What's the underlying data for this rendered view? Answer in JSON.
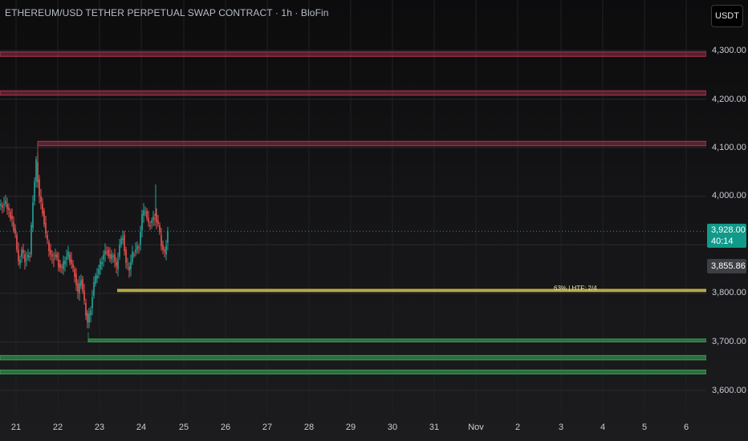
{
  "header": {
    "title": "ETHEREUM/USD TETHER PERPETUAL SWAP CONTRACT · 1h · BloFin",
    "currency_button": "USDT"
  },
  "price_axis": {
    "ticks": [
      "4,300.00",
      "4,200.00",
      "4,100.00",
      "4,000.00",
      "3,800.00",
      "3,700.00",
      "3,600.00"
    ],
    "last_price": "3,928.00",
    "countdown": "40:14",
    "mark_price": "3,855.86"
  },
  "time_axis": {
    "labels": [
      "21",
      "22",
      "23",
      "24",
      "25",
      "26",
      "27",
      "28",
      "29",
      "30",
      "31",
      "Nov",
      "2",
      "3",
      "4",
      "5",
      "6"
    ]
  },
  "level_label": "63% | HTF: 2/4",
  "colors": {
    "up": "#26a69a",
    "down": "#ef5350",
    "resistance": "#b2354f",
    "support": "#2e7d45",
    "level_line": "#d4c24a",
    "price_line": "#11998a"
  },
  "chart_data": {
    "type": "candlestick",
    "y_range": [
      3560,
      4340
    ],
    "resistance_zones": [
      [
        4288,
        4297
      ],
      [
        4208,
        4217
      ],
      [
        4104,
        4113
      ]
    ],
    "support_zones": [
      [
        3700,
        3706
      ],
      [
        3663,
        3672
      ],
      [
        3634,
        3642
      ]
    ],
    "level_line": 3806,
    "last_price": 3928,
    "mark_price": 3855.86
  }
}
